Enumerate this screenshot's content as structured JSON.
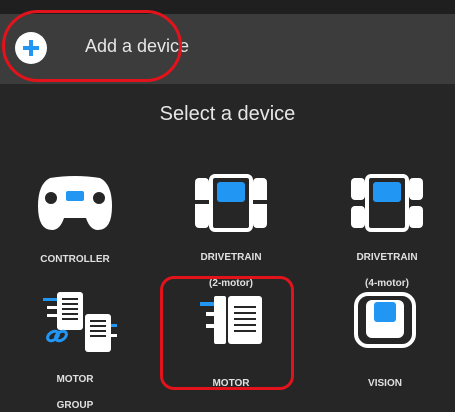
{
  "header": {
    "add_device_label": "Add a device"
  },
  "section": {
    "title": "Select a device"
  },
  "devices": [
    {
      "label": "CONTROLLER",
      "sublabel": ""
    },
    {
      "label": "DRIVETRAIN",
      "sublabel": "(2-motor)"
    },
    {
      "label": "DRIVETRAIN",
      "sublabel": "(4-motor)"
    },
    {
      "label": "MOTOR",
      "sublabel": "GROUP"
    },
    {
      "label": "MOTOR",
      "sublabel": ""
    },
    {
      "label": "VISION",
      "sublabel": ""
    }
  ],
  "colors": {
    "background": "#262626",
    "header": "#3c3c3c",
    "accent": "#2196f3",
    "annotation": "#e3131b"
  },
  "icons": {
    "add": "plus-icon",
    "controller": "controller-icon",
    "drivetrain_2": "drivetrain-2-motor-icon",
    "drivetrain_4": "drivetrain-4-motor-icon",
    "motor_group": "motor-group-icon",
    "motor": "motor-icon",
    "vision": "vision-sensor-icon"
  }
}
